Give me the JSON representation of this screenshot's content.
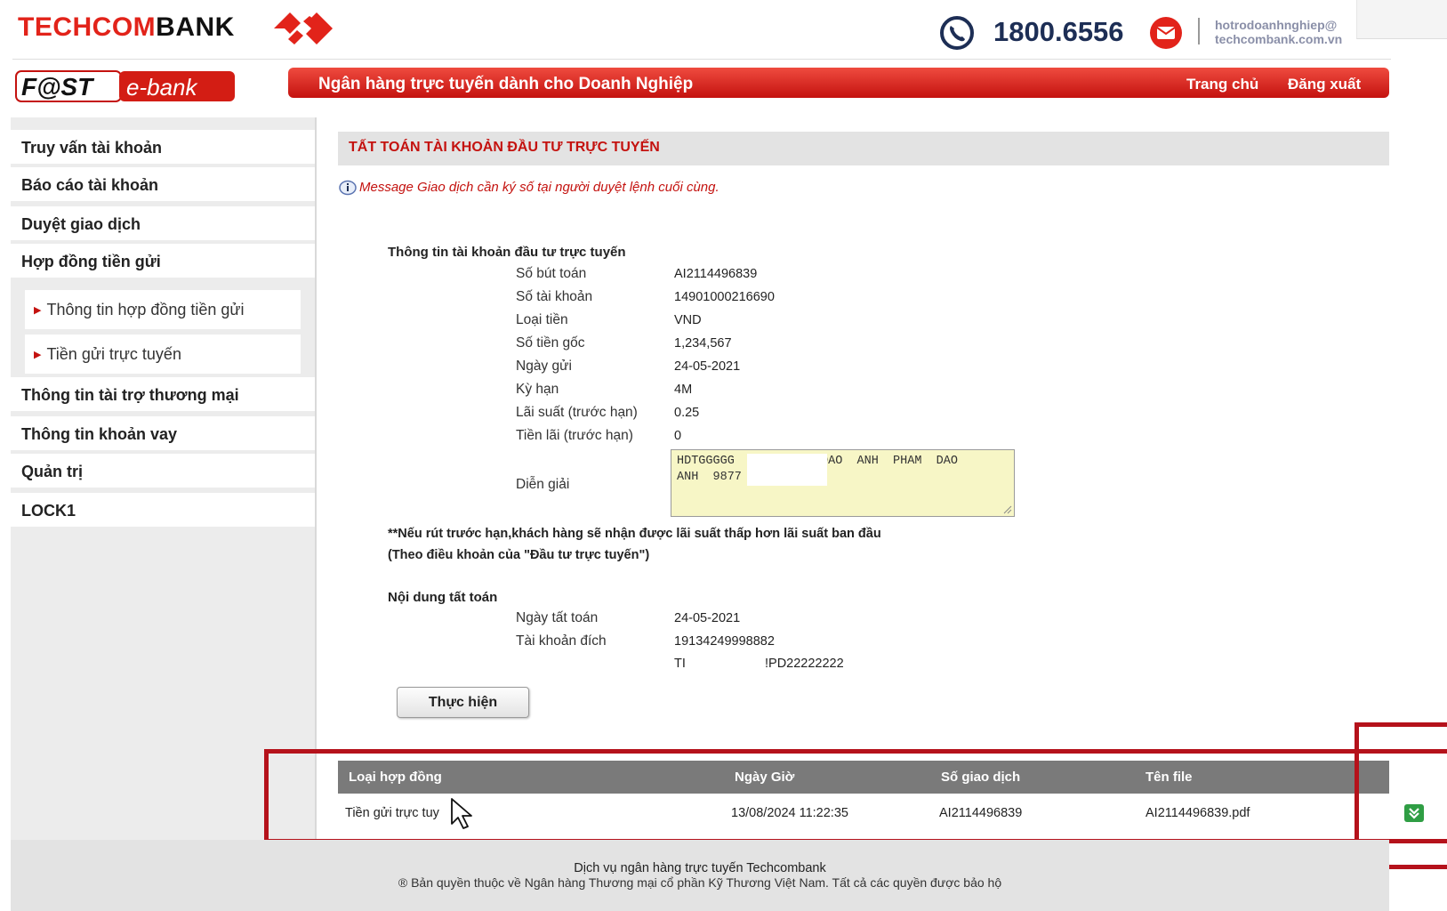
{
  "header": {
    "brand_part1": "TECHCOM",
    "brand_part2": "BANK",
    "hotline": "1800.6556",
    "support_email_line1": "hotrodoanhnghiep@",
    "support_email_line2": "techcombank.com.vn"
  },
  "banner": {
    "logo_fast": "F@ST",
    "logo_ebank": "e-bank",
    "title": "Ngân hàng trực tuyến dành cho Doanh Nghiệp",
    "home_link": "Trang chủ",
    "logout_link": "Đăng xuất"
  },
  "sidebar": {
    "items": [
      {
        "label": "Truy vấn tài khoản"
      },
      {
        "label": "Báo cáo tài khoản"
      },
      {
        "label": "Duyệt giao dịch"
      },
      {
        "label": "Hợp đồng tiền gửi"
      },
      {
        "label": "Thông tin tài trợ thương mại"
      },
      {
        "label": "Thông tin khoản vay"
      },
      {
        "label": "Quản trị"
      },
      {
        "label": "LOCK1"
      }
    ],
    "sub_items": [
      {
        "label": "Thông tin hợp đồng tiền gửi"
      },
      {
        "label": "Tiền gửi trực tuyến"
      }
    ]
  },
  "main": {
    "section_title": "TẤT TOÁN TÀI KHOẢN ĐẦU TƯ TRỰC TUYẾN",
    "message": "Message Giao dịch cần ký số tại người duyệt lệnh cuối cùng.",
    "account_info_heading": "Thông tin tài khoản đầu tư trực tuyến",
    "fields": [
      {
        "label": "Số bút toán",
        "value": "AI2114496839"
      },
      {
        "label": "Số tài khoản",
        "value": "14901000216690"
      },
      {
        "label": "Loại tiền",
        "value": "VND"
      },
      {
        "label": "Số tiền gốc",
        "value": "1,234,567"
      },
      {
        "label": "Ngày gửi",
        "value": "24-05-2021"
      },
      {
        "label": "Kỳ hạn",
        "value": "4M"
      },
      {
        "label": "Lãi suất (trước hạn)",
        "value": "0.25"
      },
      {
        "label": "Tiền lãi (trước hạn)",
        "value": "0"
      }
    ],
    "description_label": "Diễn giải",
    "description_value": "HDTGGGGG          1 DAO  ANH  PHAM  DAO\nANH  9877",
    "note_line1": "**Nếu rút trước hạn,khách hàng sẽ nhận được lãi suất thấp hơn lãi suất ban đầu",
    "note_line2": "(Theo điều khoản của \"Đầu tư trực tuyến\")",
    "settlement_heading": "Nội dung tất toán",
    "settlement_fields": [
      {
        "label": "Ngày tất toán",
        "value": "24-05-2021"
      },
      {
        "label": "Tài khoản đích",
        "value": "19134249998882"
      }
    ],
    "settlement_extra_left": "TI",
    "settlement_extra_right": "!PD22222222",
    "submit_label": "Thực hiện"
  },
  "table": {
    "headers": [
      "Loại hợp đồng",
      "Ngày Giờ",
      "Số giao dịch",
      "Tên file"
    ],
    "rows": [
      [
        "Tiền gửi trực tuy",
        "13/08/2024 11:22:35",
        "AI2114496839",
        "AI2114496839.pdf"
      ]
    ]
  },
  "footer": {
    "line1": "Dịch vụ ngân hàng trực tuyến Techcombank",
    "line2": "® Bản quyền thuộc về Ngân hàng Thương mại cổ phần Kỹ Thương Việt Nam. Tất cả các quyền được bảo hộ"
  },
  "icons": {
    "logo_mark": "techcombank-diamond-icon",
    "phone": "phone-icon",
    "mail": "mail-icon",
    "info": "info-icon",
    "download": "download-icon",
    "cursor": "mouse-pointer-icon"
  },
  "colors": {
    "brand_red": "#e2231a",
    "bar_red": "#c4120f",
    "highlight": "#b5121b",
    "navy": "#1d2e55",
    "download_green": "#2f9e44"
  }
}
